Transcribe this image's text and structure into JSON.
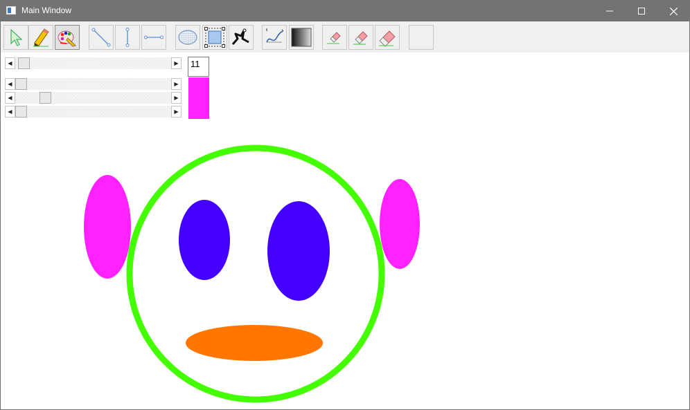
{
  "window": {
    "title": "Main Window"
  },
  "toolbar": {
    "tools": [
      {
        "id": "select",
        "icon": "pointer-arrow-icon"
      },
      {
        "id": "pencil",
        "icon": "pencil-icon"
      },
      {
        "id": "palette",
        "icon": "paint-palette-icon",
        "active": true
      },
      {
        "id": "diagonal-line",
        "icon": "diagonal-line-icon"
      },
      {
        "id": "vertical-line",
        "icon": "vertical-line-icon"
      },
      {
        "id": "horizontal-line",
        "icon": "horizontal-line-icon"
      },
      {
        "id": "ellipse",
        "icon": "ellipse-icon"
      },
      {
        "id": "rectangle-select",
        "icon": "rectangle-select-icon"
      },
      {
        "id": "freeform",
        "icon": "freeform-path-icon"
      },
      {
        "id": "curve",
        "icon": "curve-icon"
      },
      {
        "id": "gradient",
        "icon": "gradient-icon"
      },
      {
        "id": "eraser-small",
        "icon": "eraser-small-icon"
      },
      {
        "id": "eraser-medium",
        "icon": "eraser-medium-icon"
      },
      {
        "id": "eraser-large",
        "icon": "eraser-large-icon"
      },
      {
        "id": "blank",
        "icon": "blank-tool-icon"
      }
    ]
  },
  "brush": {
    "size_value": "11",
    "size_fraction": 0.02
  },
  "color_sliders": {
    "red_fraction": 0.0,
    "green_fraction": 0.17,
    "blue_fraction": 0.0
  },
  "current_color": "#ff22ff",
  "drawing": {
    "outline_color": "#44ff00",
    "ear_color": "#ff22ff",
    "eye_color": "#4400ff",
    "mouth_color": "#ff7700"
  }
}
